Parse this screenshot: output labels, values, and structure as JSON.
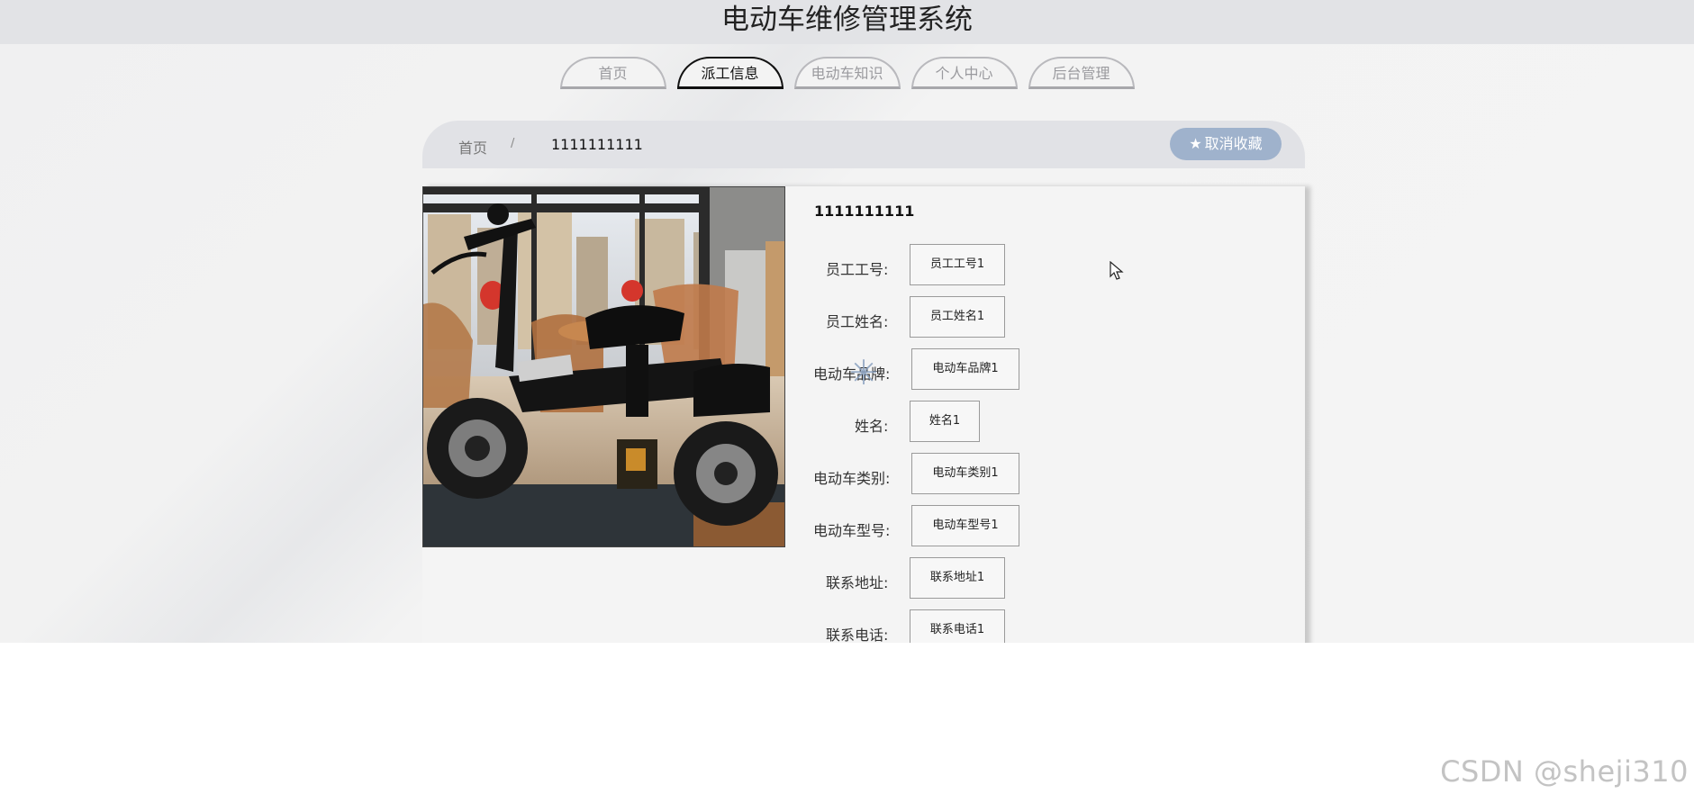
{
  "header": {
    "title": "电动车维修管理系统"
  },
  "nav": {
    "tabs": [
      {
        "label": "首页",
        "active": false
      },
      {
        "label": "派工信息",
        "active": true
      },
      {
        "label": "电动车知识",
        "active": false
      },
      {
        "label": "个人中心",
        "active": false
      },
      {
        "label": "后台管理",
        "active": false
      }
    ]
  },
  "breadcrumb": {
    "home": "首页",
    "separator": "/",
    "current": "1111111111"
  },
  "favorite_button": {
    "icon": "star-icon",
    "label": "取消收藏"
  },
  "detail": {
    "title": "1111111111",
    "image_alt": "electric-bike-photo",
    "fields": [
      {
        "label": "员工工号:",
        "value": "员工工号1"
      },
      {
        "label": "员工姓名:",
        "value": "员工姓名1"
      },
      {
        "label": "电动车品牌:",
        "value": "电动车品牌1"
      },
      {
        "label": "姓名:",
        "value": "姓名1"
      },
      {
        "label": "电动车类别:",
        "value": "电动车类别1"
      },
      {
        "label": "电动车型号:",
        "value": "电动车型号1"
      },
      {
        "label": "联系地址:",
        "value": "联系地址1"
      },
      {
        "label": "联系电话:",
        "value": "联系电话1"
      }
    ]
  },
  "watermark": "CSDN @sheji310",
  "colors": {
    "header_bg": "#e2e3e6",
    "button_bg": "#9fb2cc",
    "active_tab_border": "#111111"
  }
}
